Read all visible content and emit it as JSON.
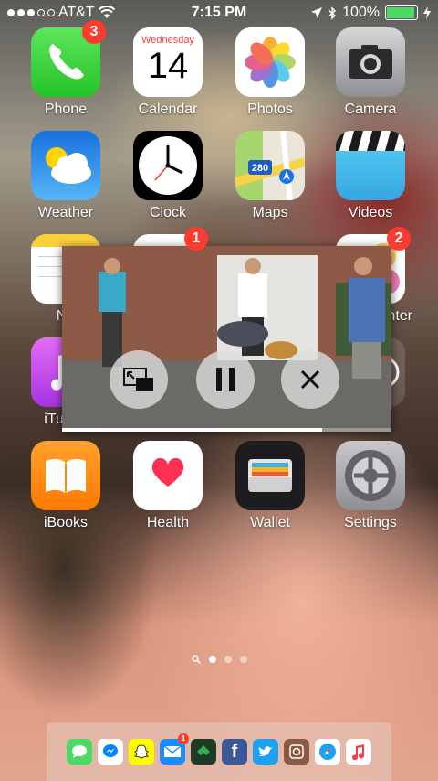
{
  "status_bar": {
    "carrier": "AT&T",
    "time": "7:15 PM",
    "battery": "100%",
    "battery_level": 1.0,
    "signal_bars": 3
  },
  "apps": [
    {
      "label": "Phone",
      "icon": "phone-icon",
      "badge": "3"
    },
    {
      "label": "Calendar",
      "icon": "calendar-icon",
      "weekday": "Wednesday",
      "day": "14"
    },
    {
      "label": "Photos",
      "icon": "photos-icon"
    },
    {
      "label": "Camera",
      "icon": "camera-icon"
    },
    {
      "label": "Weather",
      "icon": "weather-icon"
    },
    {
      "label": "Clock",
      "icon": "clock-icon"
    },
    {
      "label": "Maps",
      "icon": "maps-icon",
      "road_sign": "280"
    },
    {
      "label": "Videos",
      "icon": "videos-icon"
    },
    {
      "label": "No",
      "icon": "notes-icon"
    },
    {
      "label": "",
      "icon": "reminders-icon",
      "badge": "1"
    },
    {
      "label": "nter",
      "icon": "game-center-icon",
      "badge": "2"
    },
    {
      "label": "iTunes",
      "icon": "itunes-store-icon"
    },
    {
      "label": "iBooks",
      "icon": "ibooks-icon"
    },
    {
      "label": "Health",
      "icon": "health-icon"
    },
    {
      "label": "Wallet",
      "icon": "wallet-icon"
    },
    {
      "label": "Settings",
      "icon": "settings-icon"
    }
  ],
  "pip": {
    "controls": [
      {
        "name": "pip-restore-icon"
      },
      {
        "name": "pause-icon"
      },
      {
        "name": "close-icon"
      }
    ],
    "progress": 0.79
  },
  "pager": {
    "pages": 3,
    "current": 0
  },
  "dock": [
    {
      "icon": "messages-icon",
      "color": "#4cd964"
    },
    {
      "icon": "messenger-icon",
      "color": "#ffffff"
    },
    {
      "icon": "snapchat-icon",
      "color": "#fffc00"
    },
    {
      "icon": "mail-icon",
      "color": "#1a8cff",
      "badge": "1"
    },
    {
      "icon": "feedly-icon",
      "color": "#2bb24c"
    },
    {
      "icon": "facebook-icon",
      "color": "#3b5998"
    },
    {
      "icon": "twitter-icon",
      "color": "#1da1f2"
    },
    {
      "icon": "instagram-icon",
      "color": "#8a5a44"
    },
    {
      "icon": "safari-icon",
      "color": "#ffffff"
    },
    {
      "icon": "music-icon",
      "color": "#ffffff"
    }
  ]
}
